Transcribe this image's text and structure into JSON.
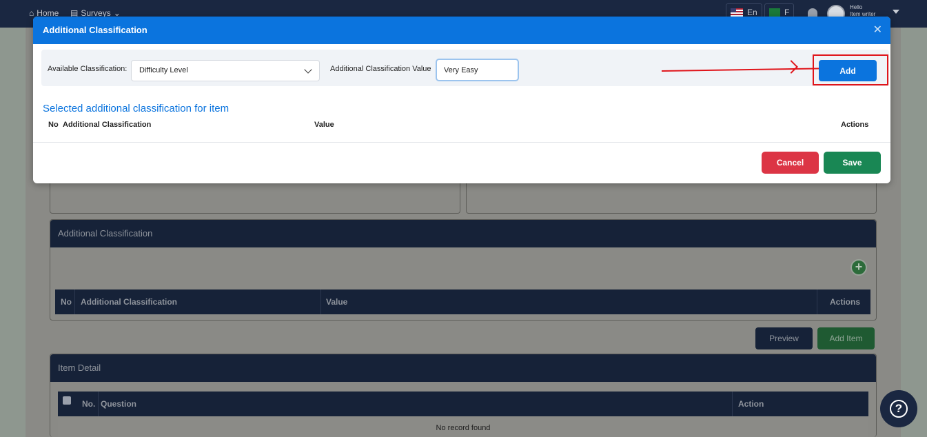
{
  "navbar": {
    "home": "Home",
    "surveys": "Surveys",
    "lang_en": "En",
    "lang_other": "F",
    "hello": "Hello",
    "user": "Item writer"
  },
  "background": {
    "additional_section_title": "Additional Classification",
    "table_headers": [
      "No",
      "Additional Classification",
      "Value",
      "Actions"
    ],
    "preview_label": "Preview",
    "add_item_label": "Add Item",
    "item_detail_title": "Item Detail",
    "item_headers": [
      "No.",
      "Question",
      "Action"
    ],
    "no_record": "No record found"
  },
  "modal": {
    "title": "Additional Classification",
    "available_label": "Available Classification:",
    "selected_classification": "Difficulty Level",
    "value_label": "Additional Classification Value",
    "value_input": "Very Easy",
    "add_label": "Add",
    "subtitle": "Selected additional classification for item",
    "headers": {
      "no": "No",
      "classification": "Additional Classification",
      "value": "Value",
      "actions": "Actions"
    },
    "cancel_label": "Cancel",
    "save_label": "Save"
  },
  "colors": {
    "primary": "#0b74de",
    "cancel": "#dc3545",
    "save": "#198754",
    "annotation": "#e0141a"
  }
}
